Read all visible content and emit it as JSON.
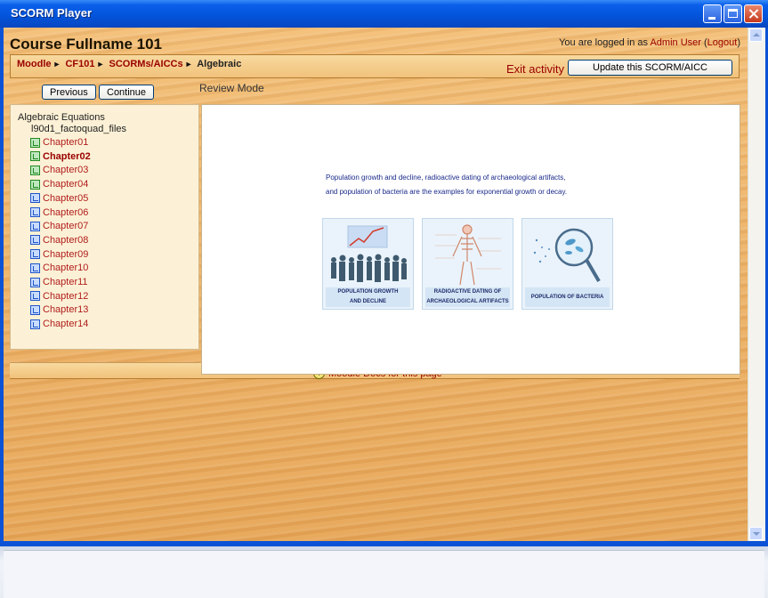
{
  "window": {
    "title": "SCORM Player"
  },
  "header": {
    "course_title": "Course Fullname 101",
    "login_prefix": "You are logged in as ",
    "user_name": "Admin User",
    "logout_open": " (",
    "logout_label": "Logout",
    "logout_close": ")"
  },
  "breadcrumb": {
    "items": [
      "Moodle",
      "CF101",
      "SCORMs/AICCs"
    ],
    "current": "Algebraic",
    "separator": "►"
  },
  "actions": {
    "exit_label": "Exit activity",
    "update_label": "Update this SCORM/AICC"
  },
  "nav": {
    "previous_label": "Previous",
    "continue_label": "Continue",
    "mode_label": "Review Mode"
  },
  "toc": {
    "root": "Algebraic Equations",
    "files": "l90d1_factoquad_files",
    "items": [
      {
        "label": "Chapter01",
        "status": "completed"
      },
      {
        "label": "Chapter02",
        "status": "completed",
        "current": true
      },
      {
        "label": "Chapter03",
        "status": "completed"
      },
      {
        "label": "Chapter04",
        "status": "completed"
      },
      {
        "label": "Chapter05",
        "status": "not-attempted"
      },
      {
        "label": "Chapter06",
        "status": "not-attempted"
      },
      {
        "label": "Chapter07",
        "status": "not-attempted"
      },
      {
        "label": "Chapter08",
        "status": "not-attempted"
      },
      {
        "label": "Chapter09",
        "status": "not-attempted"
      },
      {
        "label": "Chapter10",
        "status": "not-attempted"
      },
      {
        "label": "Chapter11",
        "status": "not-attempted"
      },
      {
        "label": "Chapter12",
        "status": "not-attempted"
      },
      {
        "label": "Chapter13",
        "status": "not-attempted"
      },
      {
        "label": "Chapter14",
        "status": "not-attempted"
      }
    ]
  },
  "content": {
    "line1": "Population growth and decline, radioactive dating of archaeological artifacts,",
    "line2": "and population of bacteria are the examples for exponential growth or decay.",
    "cards": [
      {
        "caption_line1": "POPULATION GROWTH",
        "caption_line2": "AND DECLINE"
      },
      {
        "caption_line1": "RADIOACTIVE DATING OF",
        "caption_line2": "ARCHAEOLOGICAL ARTIFACTS"
      },
      {
        "caption_line1": "POPULATION OF BACTERIA",
        "caption_line2": ""
      }
    ]
  },
  "footer": {
    "docs_label": "Moodle Docs for this page"
  },
  "colors": {
    "link": "#990000",
    "titlebar": "#0355dc",
    "wood": "#e6a556",
    "completed": "#1f8a1f",
    "not_attempted": "#1f55c9"
  }
}
